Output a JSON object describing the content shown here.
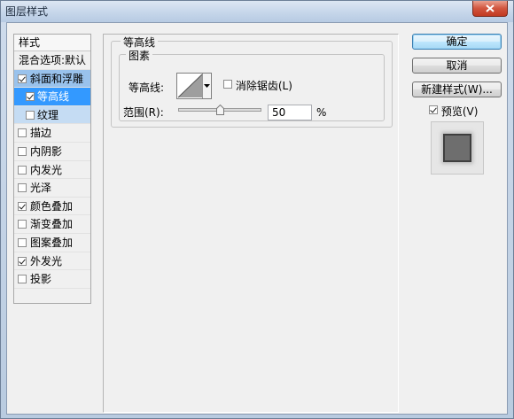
{
  "window": {
    "title": "图层样式"
  },
  "style_list": {
    "header": "样式",
    "blend_options": "混合选项:默认",
    "items": [
      {
        "label": "斜面和浮雕",
        "checked": true
      },
      {
        "label": "等高线",
        "checked": true
      },
      {
        "label": "纹理",
        "checked": false
      },
      {
        "label": "描边",
        "checked": false
      },
      {
        "label": "内阴影",
        "checked": false
      },
      {
        "label": "内发光",
        "checked": false
      },
      {
        "label": "光泽",
        "checked": false
      },
      {
        "label": "颜色叠加",
        "checked": true
      },
      {
        "label": "渐变叠加",
        "checked": false
      },
      {
        "label": "图案叠加",
        "checked": false
      },
      {
        "label": "外发光",
        "checked": true
      },
      {
        "label": "投影",
        "checked": false
      }
    ]
  },
  "contour_panel": {
    "group_title": "等高线",
    "inner_title": "图素",
    "contour_label": "等高线:",
    "antialias_label": "消除锯齿(L)",
    "antialias_checked": false,
    "range_label": "范围(R):",
    "range_value": "50",
    "range_unit": "%",
    "range_fraction": 0.5
  },
  "buttons": {
    "ok": "确定",
    "cancel": "取消",
    "new_style": "新建样式(W)...",
    "preview_label": "预览(V)",
    "preview_checked": true
  },
  "colors": {
    "selected_item": "#3399ff",
    "selected_parent": "#99c2ec",
    "preview_swatch": "#6e6e6e"
  }
}
